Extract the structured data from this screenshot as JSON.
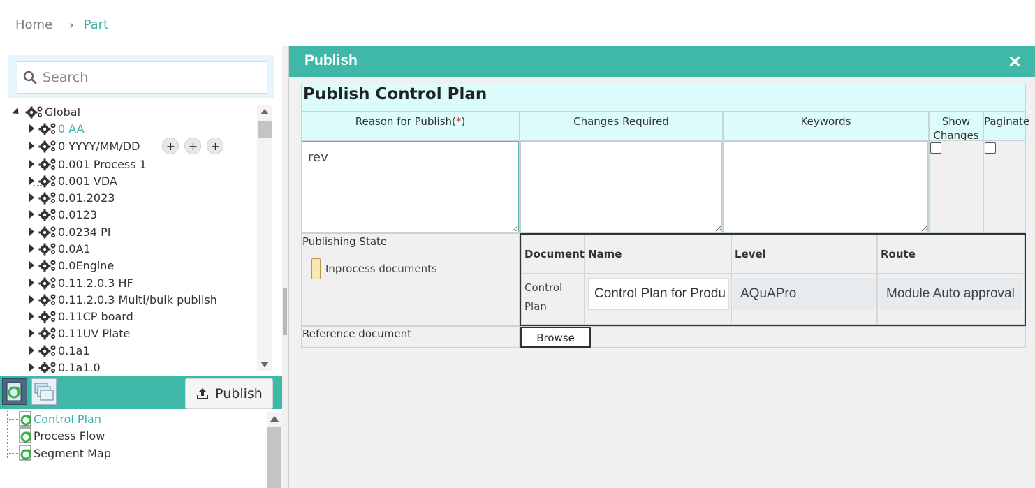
{
  "breadcrumb": {
    "home": "Home",
    "separator": "›",
    "current": "Part"
  },
  "search": {
    "placeholder": "Search"
  },
  "tree": {
    "root": "Global",
    "items": [
      {
        "label": "0 AA",
        "selected": true
      },
      {
        "label": "0 YYYY/MM/DD"
      },
      {
        "label": "0.001 Process 1"
      },
      {
        "label": "0.001 VDA"
      },
      {
        "label": "0.01.2023"
      },
      {
        "label": "0.0123"
      },
      {
        "label": "0.0234 PI"
      },
      {
        "label": "0.0A1"
      },
      {
        "label": "0.0Engine"
      },
      {
        "label": "0.11.2.0.3 HF"
      },
      {
        "label": "0.11.2.0.3 Multi/bulk publish"
      },
      {
        "label": "0.11CP board"
      },
      {
        "label": "0.11UV Plate"
      },
      {
        "label": "0.1a1"
      },
      {
        "label": "0.1a1.0"
      }
    ],
    "row_actions": [
      "+",
      "+",
      "+"
    ]
  },
  "toolbar": {
    "publish_label": "Publish"
  },
  "doc_tree": {
    "items": [
      {
        "label": "Control Plan",
        "selected": true
      },
      {
        "label": "Process Flow"
      },
      {
        "label": "Segment Map"
      }
    ]
  },
  "dialog": {
    "title": "Publish",
    "close": "×",
    "form_title": "Publish Control Plan",
    "headers": {
      "reason": "Reason for Publish(",
      "reason_req": "*",
      "reason_end": ")",
      "changes": "Changes Required",
      "keywords": "Keywords",
      "show_changes_1": "Show",
      "show_changes_2": "Changes",
      "paginate": "Paginate"
    },
    "reason_value": "rev",
    "changes_value": "",
    "keywords_value": "",
    "show_changes_checked": false,
    "paginate_checked": false,
    "publishing_state_label": "Publishing State",
    "legend_label": "Inprocess documents",
    "route_table": {
      "headers": {
        "document": "Document",
        "name": "Name",
        "level": "Level",
        "route": "Route"
      },
      "row": {
        "document": "Control Plan",
        "name": "Control Plan for Produ",
        "level": "AQuAPro",
        "route": "Module Auto approval"
      }
    },
    "reference_label": "Reference document",
    "browse_label": "Browse"
  },
  "colors": {
    "accent": "#3fb8a8",
    "header_bg": "#dcfcfc",
    "selected_text": "#3fb1a4",
    "required": "#e02020"
  }
}
